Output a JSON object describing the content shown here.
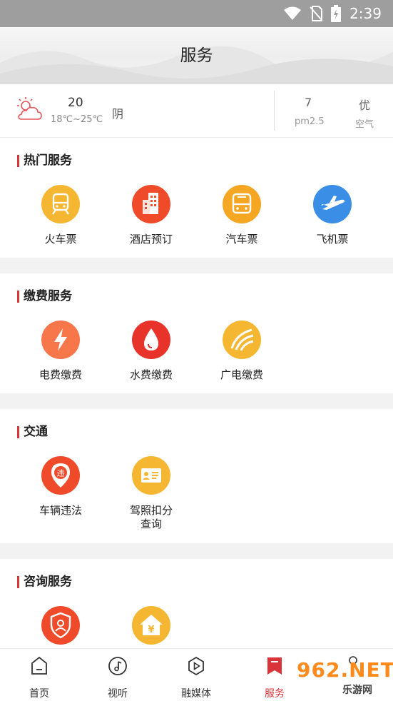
{
  "status_bar": {
    "time": "2:39"
  },
  "header": {
    "title": "服务"
  },
  "weather": {
    "temp": "20",
    "range": "18℃~25℃",
    "condition": "阴",
    "aqi_value": "7",
    "aqi_label": "pm2.5",
    "quality_value": "优",
    "quality_label": "空气"
  },
  "sections": {
    "hot": {
      "title": "热门服务",
      "items": [
        {
          "label": "火车票",
          "icon": "train-icon",
          "color": "#f5b731"
        },
        {
          "label": "酒店预订",
          "icon": "hotel-icon",
          "color": "#ef4b2b"
        },
        {
          "label": "汽车票",
          "icon": "bus-icon",
          "color": "#f5a623"
        },
        {
          "label": "飞机票",
          "icon": "plane-icon",
          "color": "#3a8ee6"
        }
      ]
    },
    "pay": {
      "title": "缴费服务",
      "items": [
        {
          "label": "电费缴费",
          "icon": "lightning-icon",
          "color": "#f7764a"
        },
        {
          "label": "水费缴费",
          "icon": "water-drop-icon",
          "color": "#e8332b"
        },
        {
          "label": "广电缴费",
          "icon": "broadcast-icon",
          "color": "#f5b731"
        }
      ]
    },
    "traffic": {
      "title": "交通",
      "items": [
        {
          "label": "车辆违法",
          "icon": "violation-icon",
          "color": "#ef4b2b"
        },
        {
          "label": "驾照扣分\n查询",
          "icon": "license-icon",
          "color": "#f5b731"
        }
      ]
    },
    "consult": {
      "title": "咨询服务",
      "items": [
        {
          "label": "",
          "icon": "shield-user-icon",
          "color": "#ef4b2b"
        },
        {
          "label": "",
          "icon": "house-yuan-icon",
          "color": "#f5b731"
        }
      ]
    }
  },
  "tabbar": {
    "tabs": [
      {
        "label": "首页",
        "icon": "home-icon"
      },
      {
        "label": "视听",
        "icon": "music-icon"
      },
      {
        "label": "融媒体",
        "icon": "play-icon"
      },
      {
        "label": "服务",
        "icon": "bookmark-icon",
        "active": true
      },
      {
        "label": "",
        "icon": "user-icon"
      }
    ]
  },
  "watermark": {
    "brand": "962.NET",
    "sub": "乐游网"
  }
}
